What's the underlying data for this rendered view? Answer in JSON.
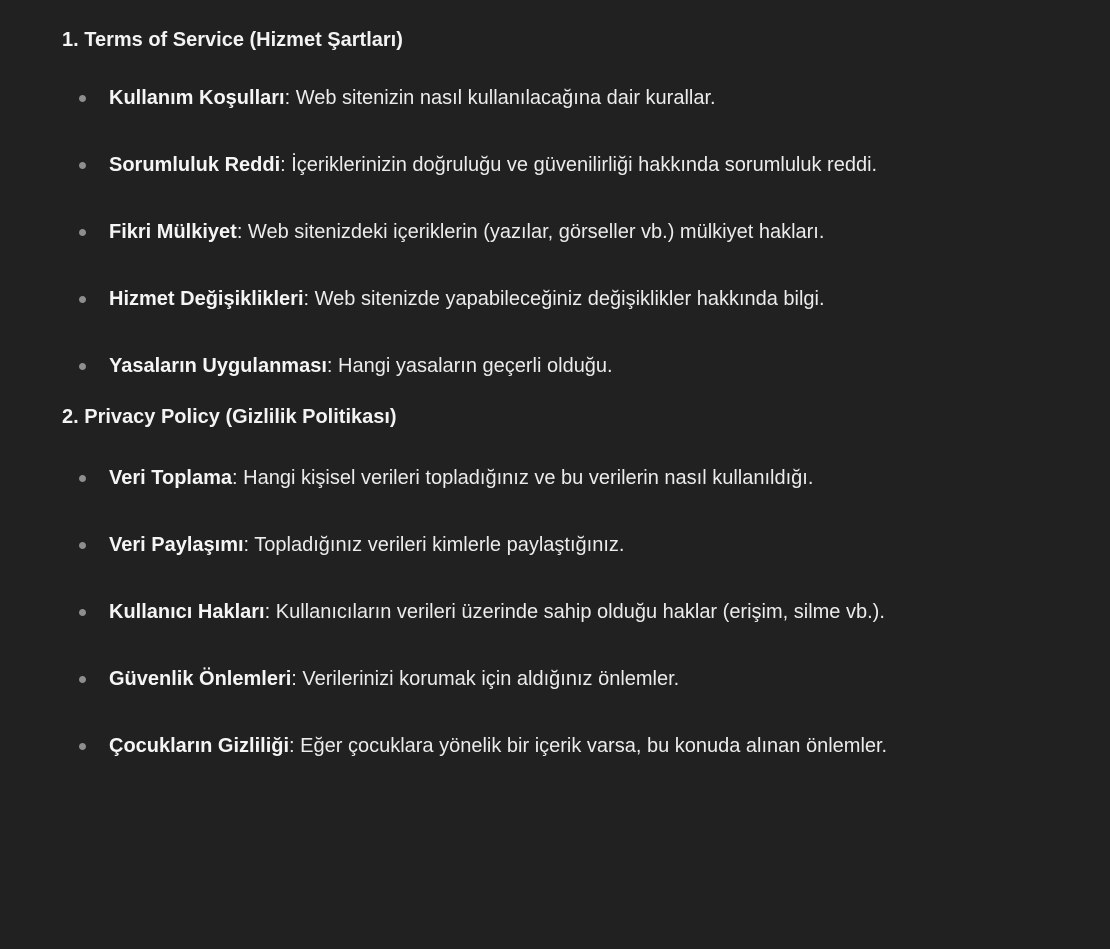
{
  "sections": [
    {
      "heading": "1. Terms of Service (Hizmet Şartları)",
      "items": [
        {
          "term": "Kullanım Koşulları",
          "desc": ": Web sitenizin nasıl kullanılacağına dair kurallar."
        },
        {
          "term": "Sorumluluk Reddi",
          "desc": ": İçeriklerinizin doğruluğu ve güvenilirliği hakkında sorumluluk reddi."
        },
        {
          "term": "Fikri Mülkiyet",
          "desc": ": Web sitenizdeki içeriklerin (yazılar, görseller vb.) mülkiyet hakları."
        },
        {
          "term": "Hizmet Değişiklikleri",
          "desc": ": Web sitenizde yapabileceğiniz değişiklikler hakkında bilgi."
        },
        {
          "term": "Yasaların Uygulanması",
          "desc": ": Hangi yasaların geçerli olduğu."
        }
      ]
    },
    {
      "heading": "2. Privacy Policy (Gizlilik Politikası)",
      "items": [
        {
          "term": "Veri Toplama",
          "desc": ": Hangi kişisel verileri topladığınız ve bu verilerin nasıl kullanıldığı."
        },
        {
          "term": "Veri Paylaşımı",
          "desc": ": Topladığınız verileri kimlerle paylaştığınız."
        },
        {
          "term": "Kullanıcı Hakları",
          "desc": ": Kullanıcıların verileri üzerinde sahip olduğu haklar (erişim, silme vb.)."
        },
        {
          "term": "Güvenlik Önlemleri",
          "desc": ": Verilerinizi korumak için aldığınız önlemler."
        },
        {
          "term": "Çocukların Gizliliği",
          "desc": ": Eğer çocuklara yönelik bir içerik varsa, bu konuda alınan önlemler."
        }
      ]
    }
  ]
}
